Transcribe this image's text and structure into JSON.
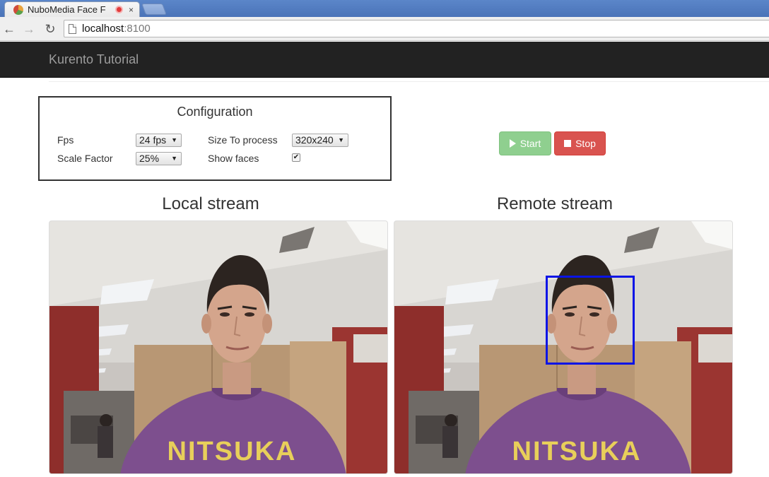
{
  "browser": {
    "tab_title": "NuboMedia Face F",
    "tab_close": "×",
    "url_host": "localhost",
    "url_port": ":8100",
    "icons": [
      "back-arrow-icon",
      "forward-arrow-icon",
      "reload-icon",
      "page-icon",
      "recording-icon",
      "favicon"
    ]
  },
  "navbar": {
    "brand": "Kurento Tutorial"
  },
  "configuration": {
    "title": "Configuration",
    "fps_label": "Fps",
    "fps_value": "24 fps",
    "size_label": "Size To process",
    "size_value": "320x240",
    "scale_label": "Scale Factor",
    "scale_value": "25%",
    "show_faces_label": "Show faces",
    "show_faces_checked": true
  },
  "controls": {
    "start_label": "Start",
    "stop_label": "Stop",
    "colors": {
      "start": "#8fcf8f",
      "stop": "#d9534f"
    }
  },
  "streams": {
    "local_title": "Local stream",
    "remote_title": "Remote stream",
    "face_box_color": "#0a14e6"
  }
}
